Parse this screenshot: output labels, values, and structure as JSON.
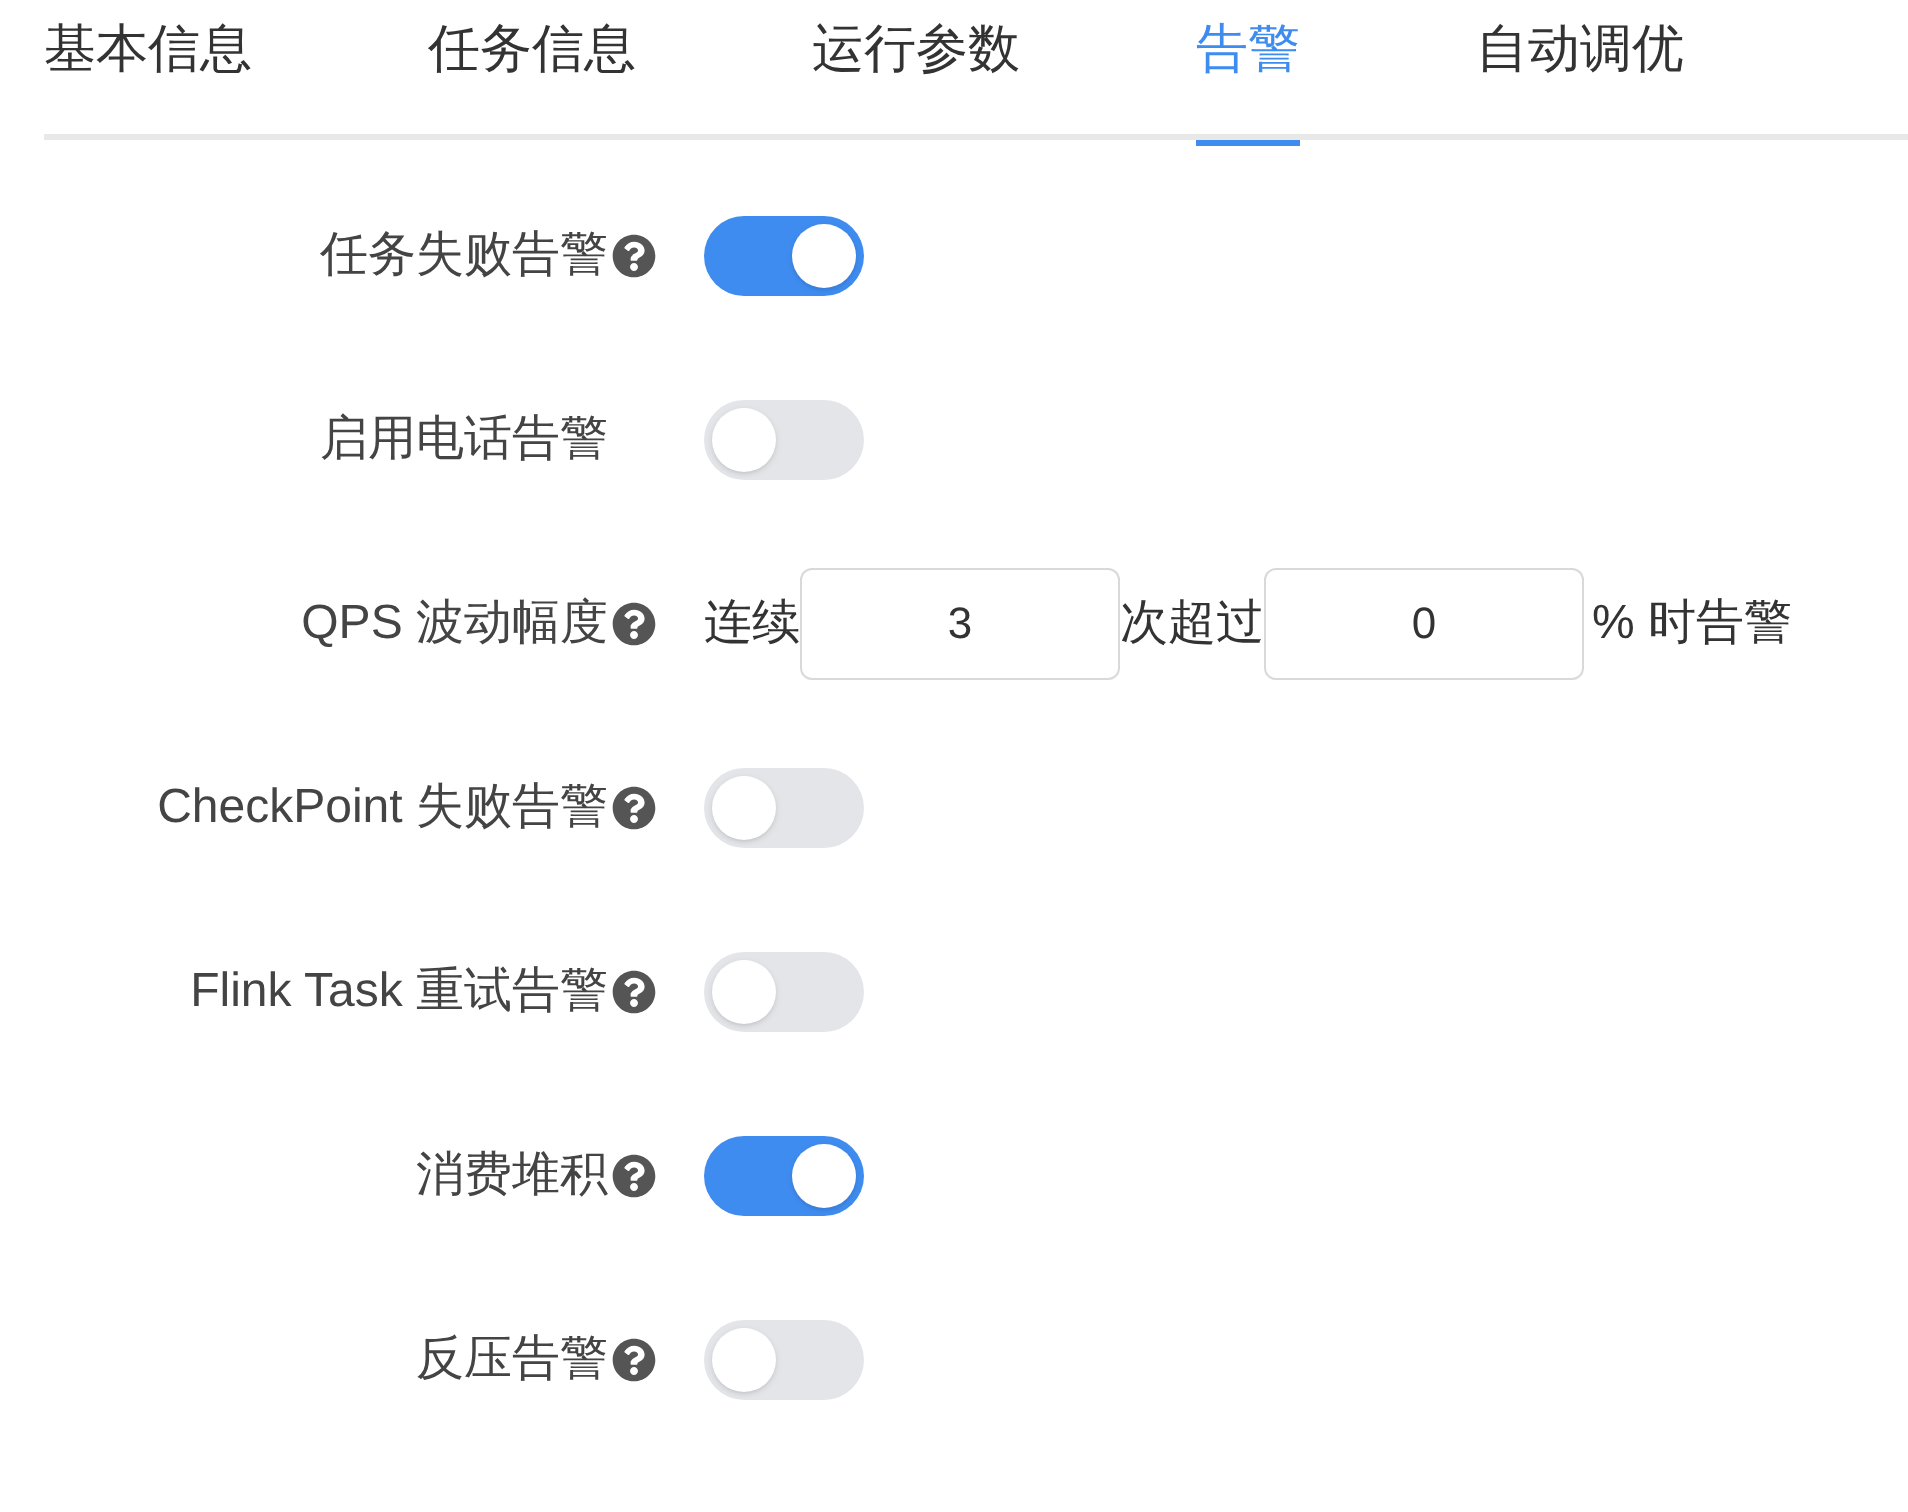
{
  "tabs": [
    {
      "label": "基本信息",
      "selected": false
    },
    {
      "label": "任务信息",
      "selected": false
    },
    {
      "label": "运行参数",
      "selected": false
    },
    {
      "label": "告警",
      "selected": true
    },
    {
      "label": "自动调优",
      "selected": false
    }
  ],
  "rows": [
    {
      "kind": "switch",
      "label": "任务失败告警",
      "help": true,
      "on": true
    },
    {
      "kind": "switch",
      "label": "启用电话告警",
      "help": false,
      "on": false
    },
    {
      "kind": "qps",
      "label": "QPS 波动幅度",
      "help": true,
      "prefix": "连续",
      "count": "3",
      "middle": "次超过",
      "percent": "0",
      "suffix": "% 时告警"
    },
    {
      "kind": "switch",
      "label": "CheckPoint 失败告警",
      "help": true,
      "on": false
    },
    {
      "kind": "switch",
      "label": "Flink Task 重试告警",
      "help": true,
      "on": false
    },
    {
      "kind": "switch",
      "label": "消费堆积",
      "help": true,
      "on": true
    },
    {
      "kind": "switch",
      "label": "反压告警",
      "help": true,
      "on": false
    }
  ]
}
